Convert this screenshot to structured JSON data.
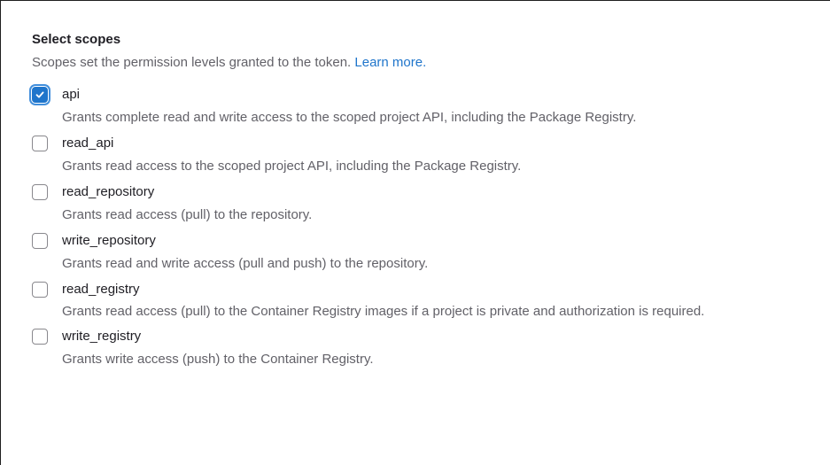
{
  "section": {
    "title": "Select scopes",
    "subtitle": "Scopes set the permission levels granted to the token.",
    "learn_more": "Learn more."
  },
  "scopes": [
    {
      "label": "api",
      "checked": true,
      "description": "Grants complete read and write access to the scoped project API, including the Package Registry."
    },
    {
      "label": "read_api",
      "checked": false,
      "description": "Grants read access to the scoped project API, including the Package Registry."
    },
    {
      "label": "read_repository",
      "checked": false,
      "description": "Grants read access (pull) to the repository."
    },
    {
      "label": "write_repository",
      "checked": false,
      "description": "Grants read and write access (pull and push) to the repository."
    },
    {
      "label": "read_registry",
      "checked": false,
      "description": "Grants read access (pull) to the Container Registry images if a project is private and authorization is required."
    },
    {
      "label": "write_registry",
      "checked": false,
      "description": "Grants write access (push) to the Container Registry."
    }
  ],
  "colors": {
    "accent": "#1f75cb",
    "text": "#1f1e24",
    "muted": "#626168"
  },
  "icons": {
    "check": "check-icon"
  }
}
